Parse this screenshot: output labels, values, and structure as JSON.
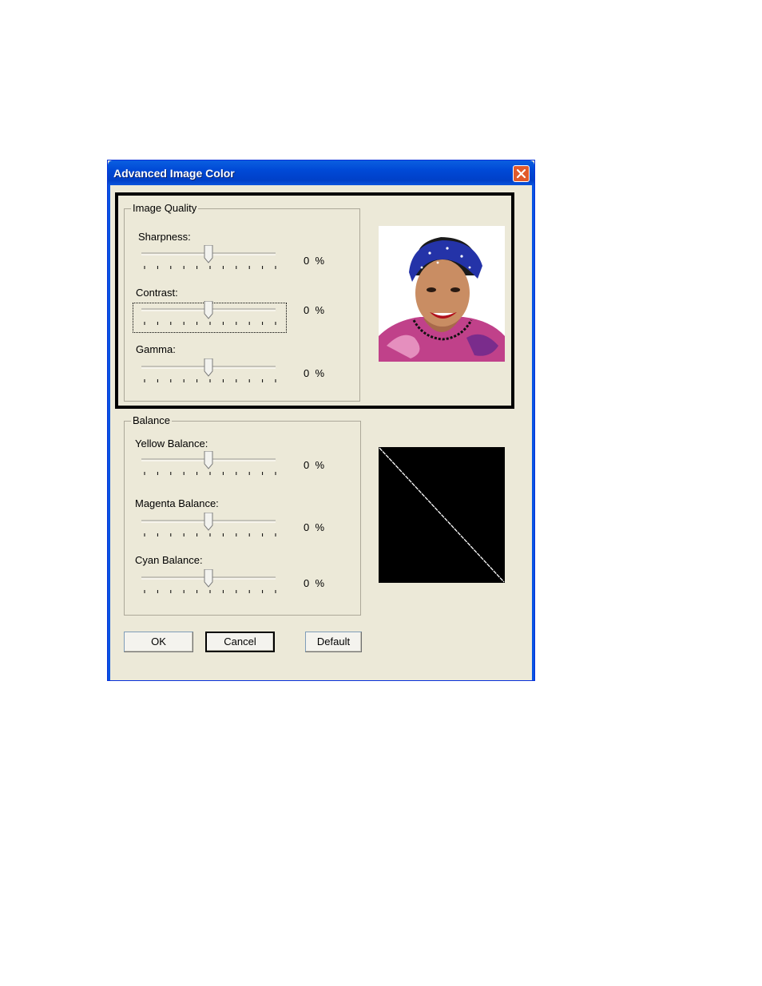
{
  "window": {
    "title": "Advanced Image Color"
  },
  "image_quality": {
    "group_label": "Image Quality",
    "sliders": [
      {
        "label": "Sharpness:",
        "value": "0",
        "unit": "%",
        "position": 0.5
      },
      {
        "label": "Contrast:",
        "value": "0",
        "unit": "%",
        "position": 0.5
      },
      {
        "label": "Gamma:",
        "value": "0",
        "unit": "%",
        "position": 0.5
      }
    ]
  },
  "balance": {
    "group_label": "Balance",
    "sliders": [
      {
        "label": "Yellow Balance:",
        "value": "0",
        "unit": "%",
        "position": 0.5
      },
      {
        "label": "Magenta Balance:",
        "value": "0",
        "unit": "%",
        "position": 0.5
      },
      {
        "label": "Cyan Balance:",
        "value": "0",
        "unit": "%",
        "position": 0.5
      }
    ]
  },
  "buttons": {
    "ok": "OK",
    "cancel": "Cancel",
    "default": "Default"
  },
  "icons": {
    "close": "close-icon"
  },
  "colors": {
    "title_bar": "#0049d6",
    "dialog_bg": "#ece9d8",
    "close_button": "#e15a2c"
  }
}
